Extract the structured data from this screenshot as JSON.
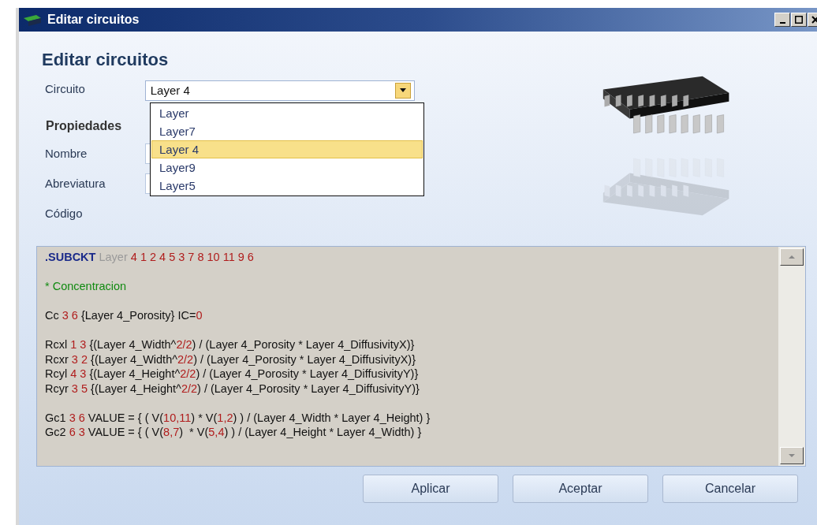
{
  "window": {
    "title": "Editar circuitos"
  },
  "heading": "Editar circuitos",
  "circuit": {
    "label": "Circuito",
    "value": "Layer 4",
    "open": true,
    "options": [
      {
        "label": "Layer",
        "selected": false
      },
      {
        "label": "Layer7",
        "selected": false
      },
      {
        "label": "Layer 4",
        "selected": true
      },
      {
        "label": "Layer9",
        "selected": false
      },
      {
        "label": "Layer5",
        "selected": false
      }
    ]
  },
  "properties_title": "Propiedades",
  "fields": [
    {
      "label": "Nombre"
    },
    {
      "label": "Abreviatura"
    }
  ],
  "code_label": "Código",
  "code_lines": [
    {
      "kind": "code",
      "tokens": [
        {
          "kind": "keyword",
          "text": ".SUBCKT "
        },
        {
          "kind": "ident",
          "text": "Layer "
        },
        {
          "kind": "number",
          "text": "4 1 2 4 5 3 7 8 10 11 9 6"
        }
      ]
    },
    {
      "kind": "blank"
    },
    {
      "kind": "code",
      "tokens": [
        {
          "kind": "comment",
          "text": "* Concentracion"
        }
      ]
    },
    {
      "kind": "blank"
    },
    {
      "kind": "code",
      "tokens": [
        {
          "kind": "text",
          "text": "Cc "
        },
        {
          "kind": "number",
          "text": "3 6"
        },
        {
          "kind": "text",
          "text": " {Layer 4_Porosity} IC="
        },
        {
          "kind": "number",
          "text": "0"
        }
      ]
    },
    {
      "kind": "blank"
    },
    {
      "kind": "code",
      "tokens": [
        {
          "kind": "text",
          "text": "Rcxl "
        },
        {
          "kind": "number",
          "text": "1 3"
        },
        {
          "kind": "text",
          "text": " {(Layer 4_Width^"
        },
        {
          "kind": "number",
          "text": "2/2"
        },
        {
          "kind": "text",
          "text": ") / (Layer 4_Porosity * Layer 4_DiffusivityX)}"
        }
      ]
    },
    {
      "kind": "code",
      "tokens": [
        {
          "kind": "text",
          "text": "Rcxr "
        },
        {
          "kind": "number",
          "text": "3 2"
        },
        {
          "kind": "text",
          "text": " {(Layer 4_Width^"
        },
        {
          "kind": "number",
          "text": "2/2"
        },
        {
          "kind": "text",
          "text": ") / (Layer 4_Porosity * Layer 4_DiffusivityX)}"
        }
      ]
    },
    {
      "kind": "code",
      "tokens": [
        {
          "kind": "text",
          "text": "Rcyl "
        },
        {
          "kind": "number",
          "text": "4 3"
        },
        {
          "kind": "text",
          "text": " {(Layer 4_Height^"
        },
        {
          "kind": "number",
          "text": "2/2"
        },
        {
          "kind": "text",
          "text": ") / (Layer 4_Porosity * Layer 4_DiffusivityY)}"
        }
      ]
    },
    {
      "kind": "code",
      "tokens": [
        {
          "kind": "text",
          "text": "Rcyr "
        },
        {
          "kind": "number",
          "text": "3 5"
        },
        {
          "kind": "text",
          "text": " {(Layer 4_Height^"
        },
        {
          "kind": "number",
          "text": "2/2"
        },
        {
          "kind": "text",
          "text": ") / (Layer 4_Porosity * Layer 4_DiffusivityY)}"
        }
      ]
    },
    {
      "kind": "blank"
    },
    {
      "kind": "code",
      "tokens": [
        {
          "kind": "text",
          "text": "Gc1 "
        },
        {
          "kind": "number",
          "text": "3 6"
        },
        {
          "kind": "text",
          "text": " VALUE = { ( V("
        },
        {
          "kind": "number",
          "text": "10,11"
        },
        {
          "kind": "text",
          "text": ") * V("
        },
        {
          "kind": "number",
          "text": "1,2"
        },
        {
          "kind": "text",
          "text": ") ) / (Layer 4_Width * Layer 4_Height) }"
        }
      ]
    },
    {
      "kind": "code",
      "tokens": [
        {
          "kind": "text",
          "text": "Gc2 "
        },
        {
          "kind": "number",
          "text": "6 3"
        },
        {
          "kind": "text",
          "text": " VALUE = { ( V("
        },
        {
          "kind": "number",
          "text": "8,7"
        },
        {
          "kind": "text",
          "text": ")  * V("
        },
        {
          "kind": "number",
          "text": "5,4"
        },
        {
          "kind": "text",
          "text": ") ) / (Layer 4_Height * Layer 4_Width) }"
        }
      ]
    }
  ],
  "buttons": [
    "Aplicar",
    "Aceptar",
    "Cancelar"
  ]
}
